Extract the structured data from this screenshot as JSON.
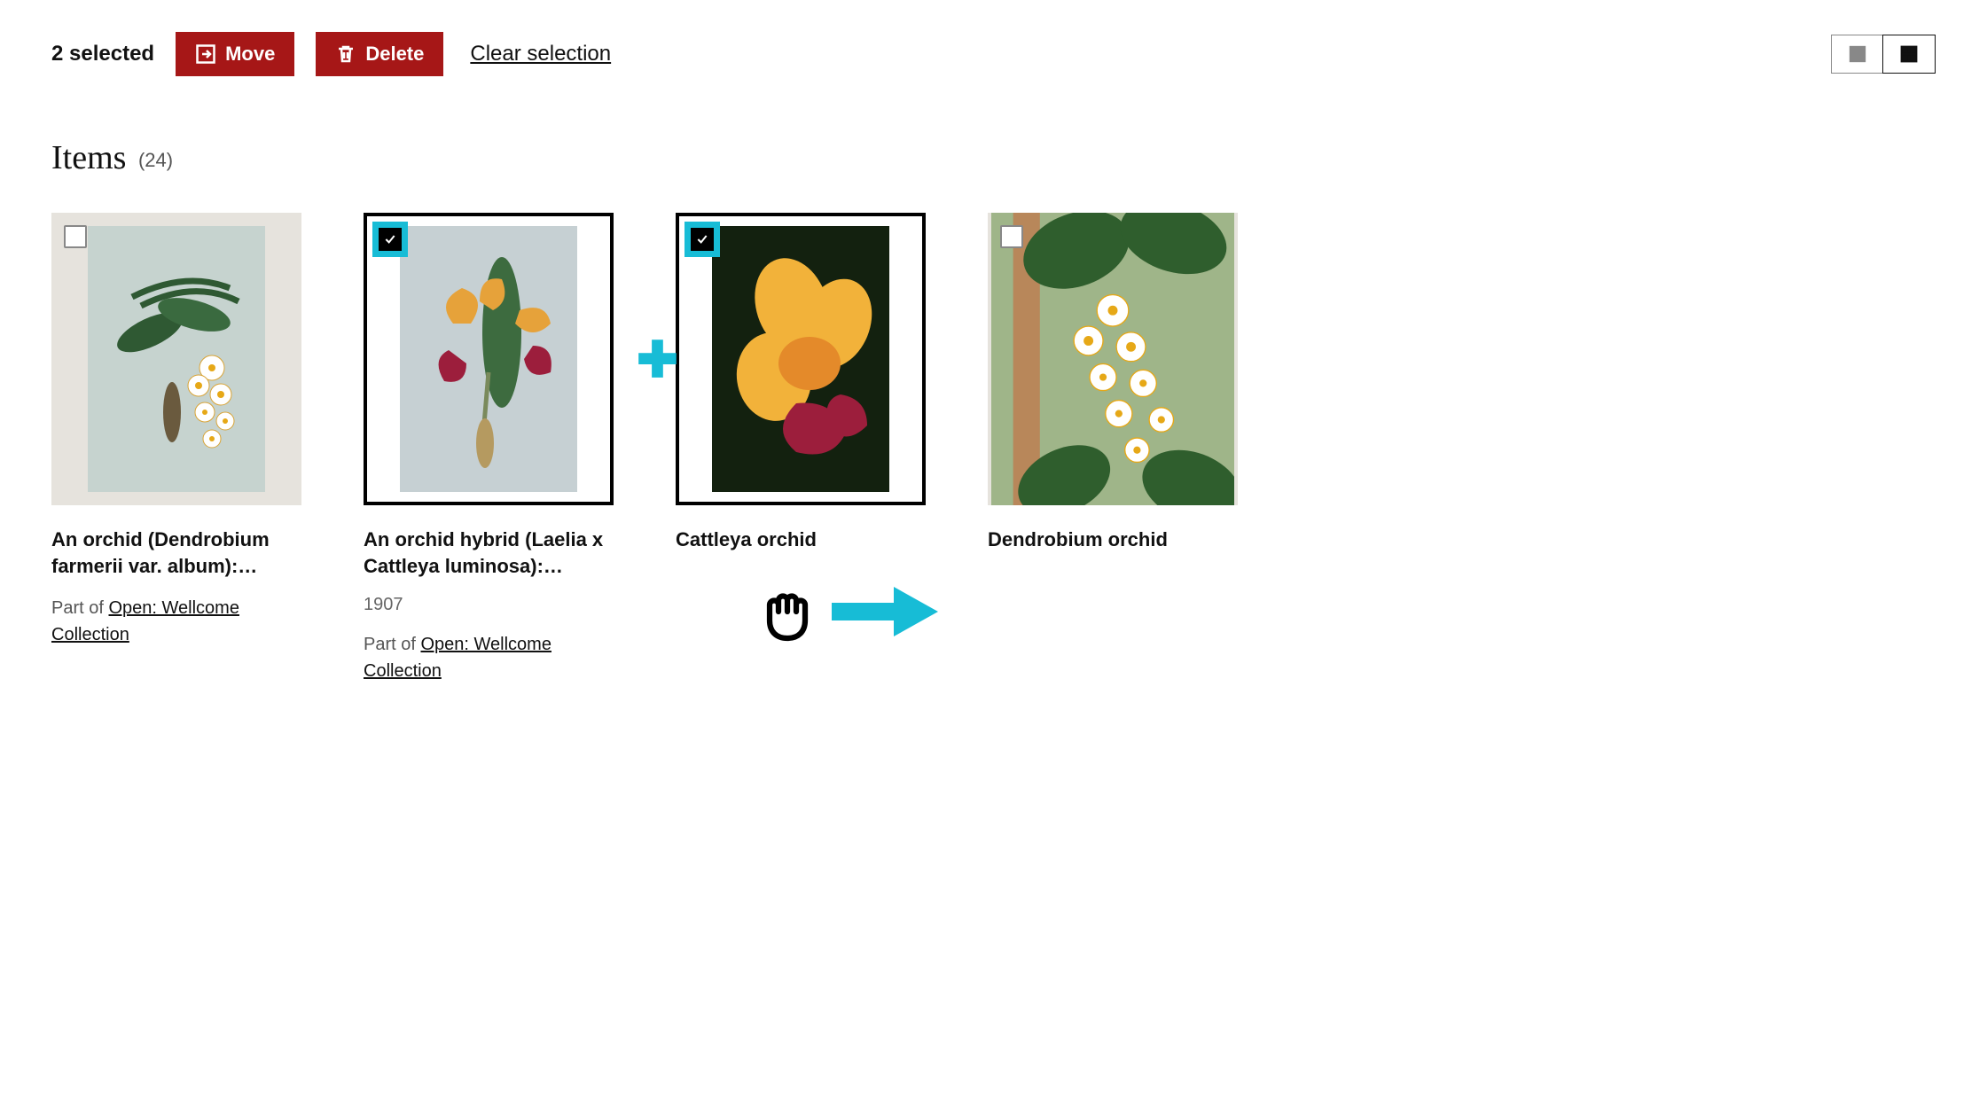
{
  "toolbar": {
    "selected_text": "2 selected",
    "move_label": "Move",
    "delete_label": "Delete",
    "clear_label": "Clear selection"
  },
  "heading": {
    "label": "Items",
    "count": "(24)"
  },
  "colors": {
    "accent": "#17bcd6",
    "primary": "#a61717"
  },
  "items": [
    {
      "title": "An orchid (Dendrobium farmerii var. album):…",
      "selected": false,
      "year": "",
      "partof_prefix": "Part of ",
      "partof_link": "Open: Wellcome Collection"
    },
    {
      "title": "An orchid hybrid (Laelia x Cattleya luminosa):…",
      "selected": true,
      "year": "1907",
      "partof_prefix": "Part of ",
      "partof_link": "Open: Wellcome Collection"
    },
    {
      "title": "Cattleya orchid",
      "selected": true,
      "year": "",
      "partof_prefix": "",
      "partof_link": ""
    },
    {
      "title": "Dendrobium orchid",
      "selected": false,
      "year": "",
      "partof_prefix": "",
      "partof_link": ""
    }
  ]
}
